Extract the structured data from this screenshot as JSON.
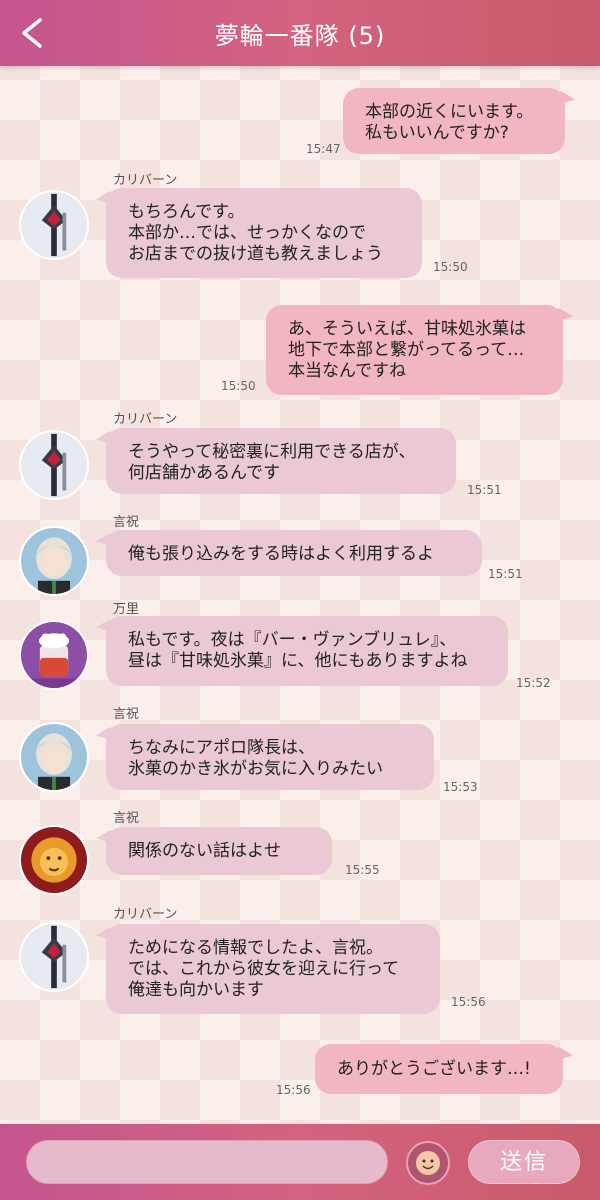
{
  "header": {
    "title": "夢輪一番隊 (5)"
  },
  "messages": [
    {
      "side": "out",
      "text": "本部の近くにいます。\n私もいいんですか?",
      "time": "15:47"
    },
    {
      "side": "in",
      "sender": "カリバーン",
      "avatar": "caliburn-sword-icon",
      "text": "もちろんです。\n本部か…では、せっかくなので\nお店までの抜け道も教えましょう",
      "time": "15:50"
    },
    {
      "side": "out",
      "text": "あ、そういえば、甘味処氷菓は\n地下で本部と繋がってるって…\n本当なんですね",
      "time": "15:50"
    },
    {
      "side": "in",
      "sender": "カリバーン",
      "avatar": "caliburn-sword-icon",
      "text": "そうやって秘密裏に利用できる店が、\n何店舗かあるんです",
      "time": "15:51"
    },
    {
      "side": "in",
      "sender": "言祝",
      "avatar": "kotohogi-portrait",
      "text": "俺も張り込みをする時はよく利用するよ",
      "time": "15:51"
    },
    {
      "side": "in",
      "sender": "万里",
      "avatar": "banri-dessert-icon",
      "text": "私もです。夜は『バー・ヴァンブリュレ』、\n昼は『甘味処氷菓』に、他にもありますよね",
      "time": "15:52"
    },
    {
      "side": "in",
      "sender": "言祝",
      "avatar": "kotohogi-portrait",
      "text": "ちなみにアポロ隊長は、\n氷菓のかき氷がお気に入りみたい",
      "time": "15:53"
    },
    {
      "side": "in",
      "sender": "言祝",
      "avatar": "lion-icon",
      "text": "関係のない話はよせ",
      "time": "15:55"
    },
    {
      "side": "in",
      "sender": "カリバーン",
      "avatar": "caliburn-sword-icon",
      "text": "ためになる情報でしたよ、言祝。\nでは、これから彼女を迎えに行って\n俺達も向かいます",
      "time": "15:56"
    },
    {
      "side": "out",
      "text": "ありがとうございます…!",
      "time": "15:56"
    }
  ],
  "footer": {
    "send_label": "送信",
    "emoji": "smiley-icon"
  },
  "colors": {
    "header": "#d4637f",
    "incoming_bubble": "#eac9d4",
    "outgoing_bubble": "#f2b6c0"
  }
}
